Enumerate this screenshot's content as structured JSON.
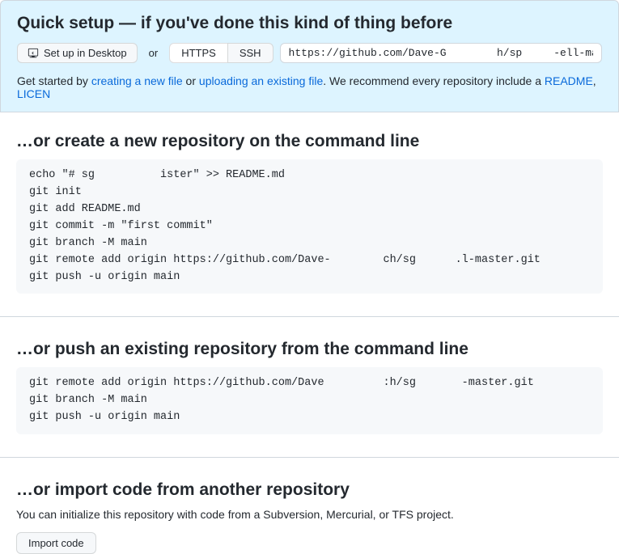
{
  "quickSetup": {
    "heading": "Quick setup — if you've done this kind of thing before",
    "desktopBtn": "Set up in Desktop",
    "orText": "or",
    "httpsBtn": "HTTPS",
    "sshBtn": "SSH",
    "cloneUrl": "https://github.com/Dave-G        h/sp     -ell-master.git",
    "helpPrefix": "Get started by ",
    "linkCreate": "creating a new file",
    "helpMid": " or ",
    "linkUpload": "uploading an existing file",
    "helpSuffix": ". We recommend every repository include a ",
    "linkReadme": "README",
    "helpComma": ", ",
    "linkLicense": "LICEN"
  },
  "createRepo": {
    "heading": "…or create a new repository on the command line",
    "code": "echo \"# sg          ister\" >> README.md\ngit init\ngit add README.md\ngit commit -m \"first commit\"\ngit branch -M main\ngit remote add origin https://github.com/Dave-        ch/sg      .l-master.git\ngit push -u origin main"
  },
  "pushExisting": {
    "heading": "…or push an existing repository from the command line",
    "code": "git remote add origin https://github.com/Dave         :h/sg       -master.git\ngit branch -M main\ngit push -u origin main"
  },
  "importRepo": {
    "heading": "…or import code from another repository",
    "desc": "You can initialize this repository with code from a Subversion, Mercurial, or TFS project.",
    "btn": "Import code"
  }
}
